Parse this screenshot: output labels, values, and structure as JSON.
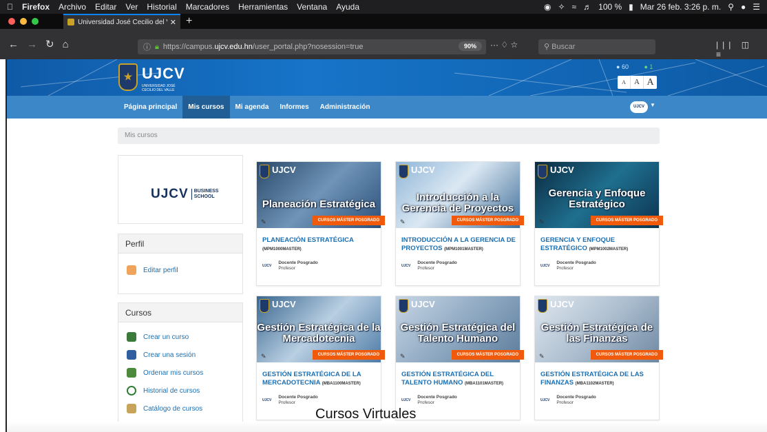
{
  "mac_menubar": {
    "apple": "",
    "items": [
      "Firefox",
      "Archivo",
      "Editar",
      "Ver",
      "Historial",
      "Marcadores",
      "Herramientas",
      "Ventana",
      "Ayuda"
    ],
    "battery": "100 %",
    "datetime": "Mar 26 feb.  3:26 p. m."
  },
  "browser": {
    "tab_title": "Universidad José Cecilio del Va",
    "url_prefix": "https://campus.",
    "url_host": "ujcv.edu.hn",
    "url_path": "/user_portal.php?nosession=true",
    "zoom": "90%",
    "search_placeholder": "Buscar"
  },
  "site": {
    "logo": "UJCV",
    "logo_sub": "UNIVERSIDAD JOSÉ CECILIO DEL VALLE",
    "stat_users": "60",
    "stat_other": "1",
    "font_buttons": [
      "A",
      "A",
      "A"
    ]
  },
  "nav": {
    "items": [
      "Página principal",
      "Mis cursos",
      "Mi agenda",
      "Informes",
      "Administración"
    ],
    "active_index": 1,
    "avatar": "UJCV"
  },
  "breadcrumb": "Mis cursos",
  "left": {
    "bs_logo": "UJCV",
    "bs_text": "BUSINESS SCHOOL",
    "perfil_title": "Perfil",
    "perfil_link": "Editar perfil",
    "cursos_title": "Cursos",
    "cursos_links": [
      "Crear un curso",
      "Crear una sesión",
      "Ordenar mis cursos",
      "Historial de cursos",
      "Catálogo de cursos"
    ]
  },
  "courses": [
    {
      "img_title": "Planeación Estratégica",
      "title": "Planeación Estratégica",
      "code": "(MPM1000MASTER)",
      "badge": "CURSOS MÁSTER POSGRADO",
      "teacher": "Docente Posgrado",
      "role": "Profesor",
      "mark": "UJCV"
    },
    {
      "img_title": "Introducción a la Gerencia de Proyectos",
      "title": "Introducción a la Gerencia de Proyectos",
      "code": "(MPM1001MASTER)",
      "badge": "CURSOS MÁSTER POSGRADO",
      "teacher": "Docente Posgrado",
      "role": "Profesor",
      "mark": "UJCV"
    },
    {
      "img_title": "Gerencia y Enfoque Estratégico",
      "title": "Gerencia y Enfoque Estratégico",
      "code": "(MPM1002MASTER)",
      "badge": "CURSOS MÁSTER POSGRADO",
      "teacher": "Docente Posgrado",
      "role": "Profesor",
      "mark": "UJCV"
    },
    {
      "img_title": "Gestión Estratégica de la Mercadotecnia",
      "title": "Gestión Estratégica de la Mercadotecnia",
      "code": "(MBA1100MASTER)",
      "badge": "CURSOS MÁSTER POSGRADO",
      "teacher": "Docente Posgrado",
      "role": "Profesor",
      "mark": "UJCV"
    },
    {
      "img_title": "Gestión Estratégica del Talento Humano",
      "title": "Gestión Estratégica del Talento Humano",
      "code": "(MBA1101MASTER)",
      "badge": "CURSOS MÁSTER POSGRADO",
      "teacher": "Docente Posgrado",
      "role": "Profesor",
      "mark": "UJCV"
    },
    {
      "img_title": "Gestión Estratégica de las Finanzas",
      "title": "Gestión Estratégica de las Finanzas",
      "code": "(MBA1102MASTER)",
      "badge": "CURSOS MÁSTER POSGRADO",
      "teacher": "Docente Posgrado",
      "role": "Profesor",
      "mark": "UJCV"
    }
  ],
  "teacher_logo": "UJCV",
  "caption": "Cursos Virtuales",
  "colors": {
    "brand_blue": "#1774c8",
    "nav_blue": "#3b87c8",
    "link": "#1a6fb3",
    "badge": "#f15a0b"
  }
}
